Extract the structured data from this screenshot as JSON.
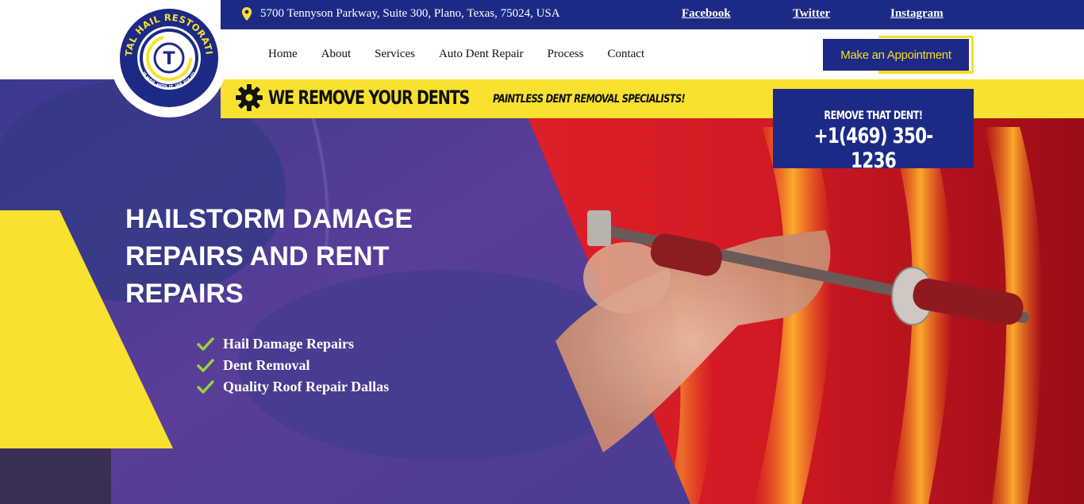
{
  "topbar": {
    "address": "5700 Tennyson Parkway, Suite 300, Plano, Texas, 75024, USA",
    "social": [
      {
        "label": "Facebook"
      },
      {
        "label": "Twitter"
      },
      {
        "label": "Instagram"
      }
    ]
  },
  "logo": {
    "text_ring": "TOTAL HAIL RESTORATION",
    "tagline": "IF HAIL HITS IT, WE FIX IT!",
    "monogram": "T"
  },
  "nav": {
    "items": [
      {
        "label": "Home"
      },
      {
        "label": "About"
      },
      {
        "label": "Services"
      },
      {
        "label": "Auto Dent Repair"
      },
      {
        "label": "Process"
      },
      {
        "label": "Contact"
      }
    ],
    "cta_label": "Make an Appointment"
  },
  "band": {
    "title": "WE REMOVE YOUR DENTS",
    "subtitle": "PAINTLESS DENT REMOVAL SPECIALISTS!",
    "icon": "gear-icon"
  },
  "phone": {
    "label": "REMOVE THAT DENT!",
    "number": "+1(469) 350-1236"
  },
  "hero": {
    "headline_line1": "HAILSTORM DAMAGE",
    "headline_line2": "REPAIRS AND RENT",
    "headline_line3": "REPAIRS",
    "bullets": [
      {
        "label": "Hail Damage Repairs"
      },
      {
        "label": "Dent Removal"
      },
      {
        "label": "Quality Roof Repair Dallas"
      }
    ],
    "bullet_icon": "check-icon"
  },
  "colors": {
    "brand_blue": "#1c2a86",
    "brand_yellow": "#f8e12f",
    "check_green": "#9ad13a",
    "car_red": "#e3232b",
    "overlay_purple": "#5a3d98"
  }
}
